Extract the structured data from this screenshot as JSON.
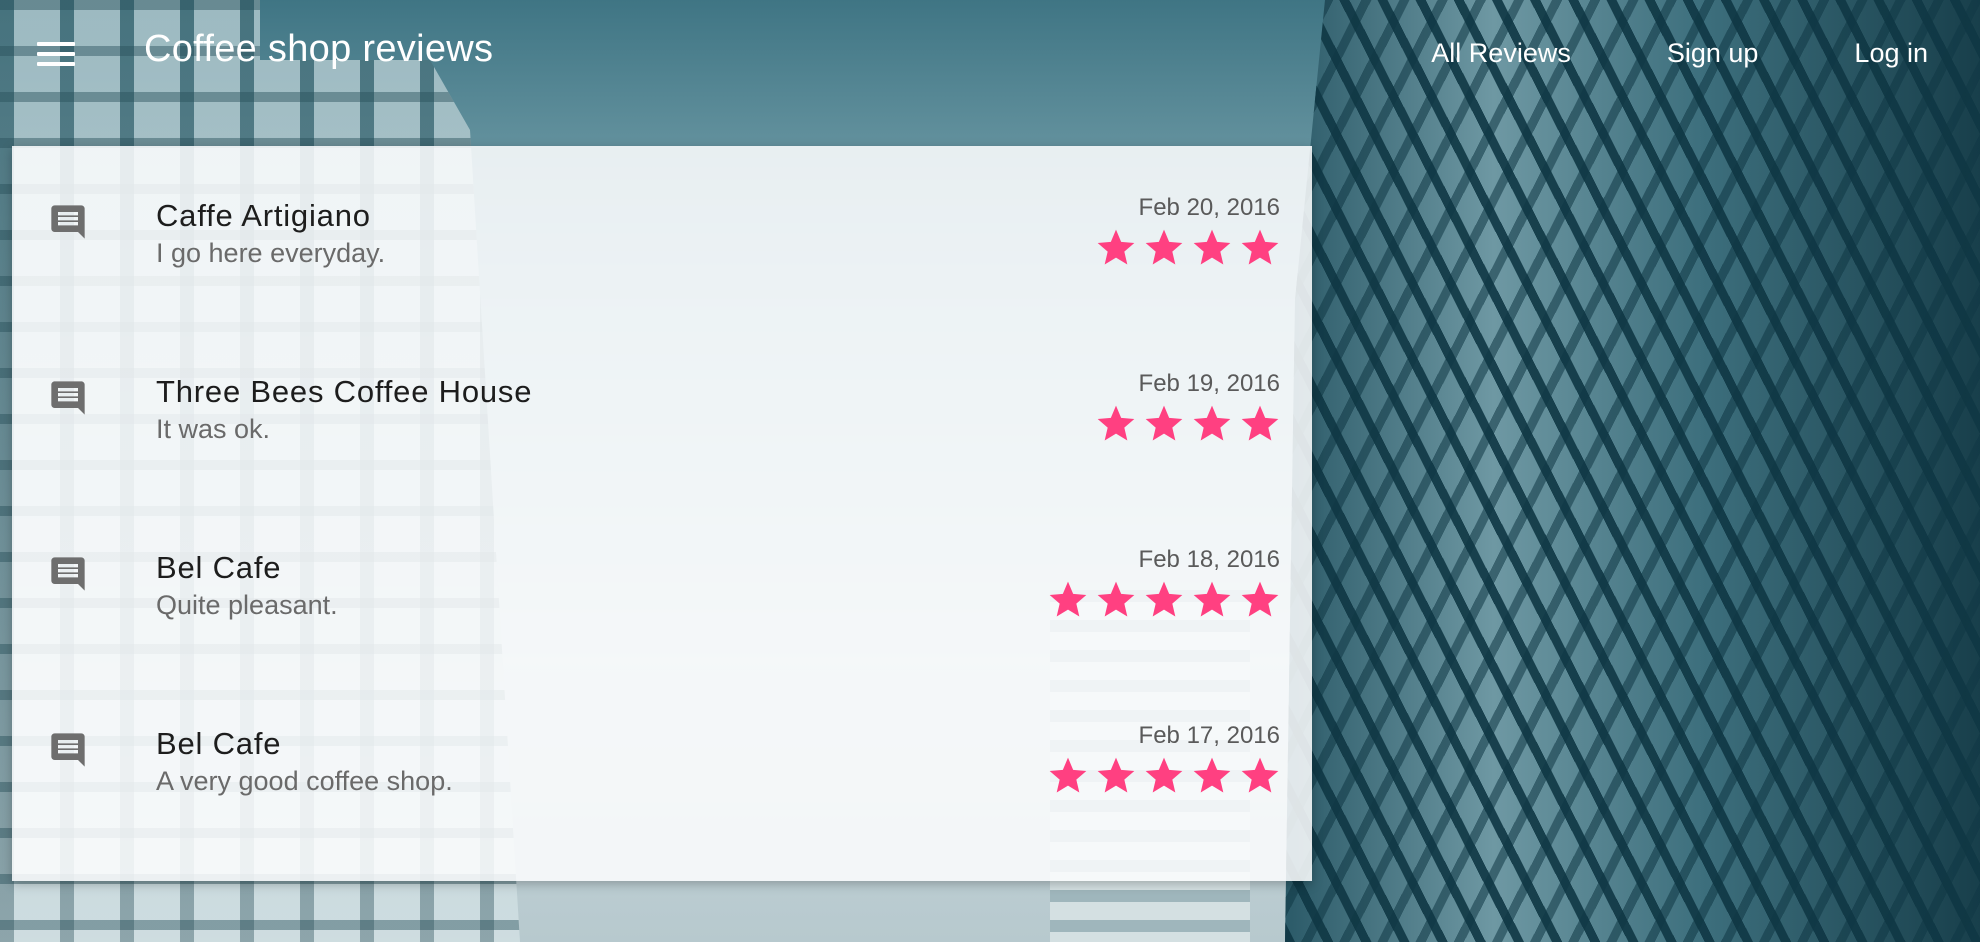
{
  "header": {
    "title": "Coffee shop reviews",
    "nav": {
      "all_reviews": "All Reviews",
      "sign_up": "Sign up",
      "log_in": "Log in"
    }
  },
  "colors": {
    "star": "#ff4081",
    "icon": "#6e6e6e"
  },
  "reviews": [
    {
      "name": "Caffe Artigiano",
      "text": "I go here everyday.",
      "date": "Feb 20, 2016",
      "stars": 4
    },
    {
      "name": "Three Bees Coffee House",
      "text": "It was ok.",
      "date": "Feb 19, 2016",
      "stars": 4
    },
    {
      "name": "Bel Cafe",
      "text": "Quite pleasant.",
      "date": "Feb 18, 2016",
      "stars": 5
    },
    {
      "name": "Bel Cafe",
      "text": "A very good coffee shop.",
      "date": "Feb 17, 2016",
      "stars": 5
    }
  ]
}
